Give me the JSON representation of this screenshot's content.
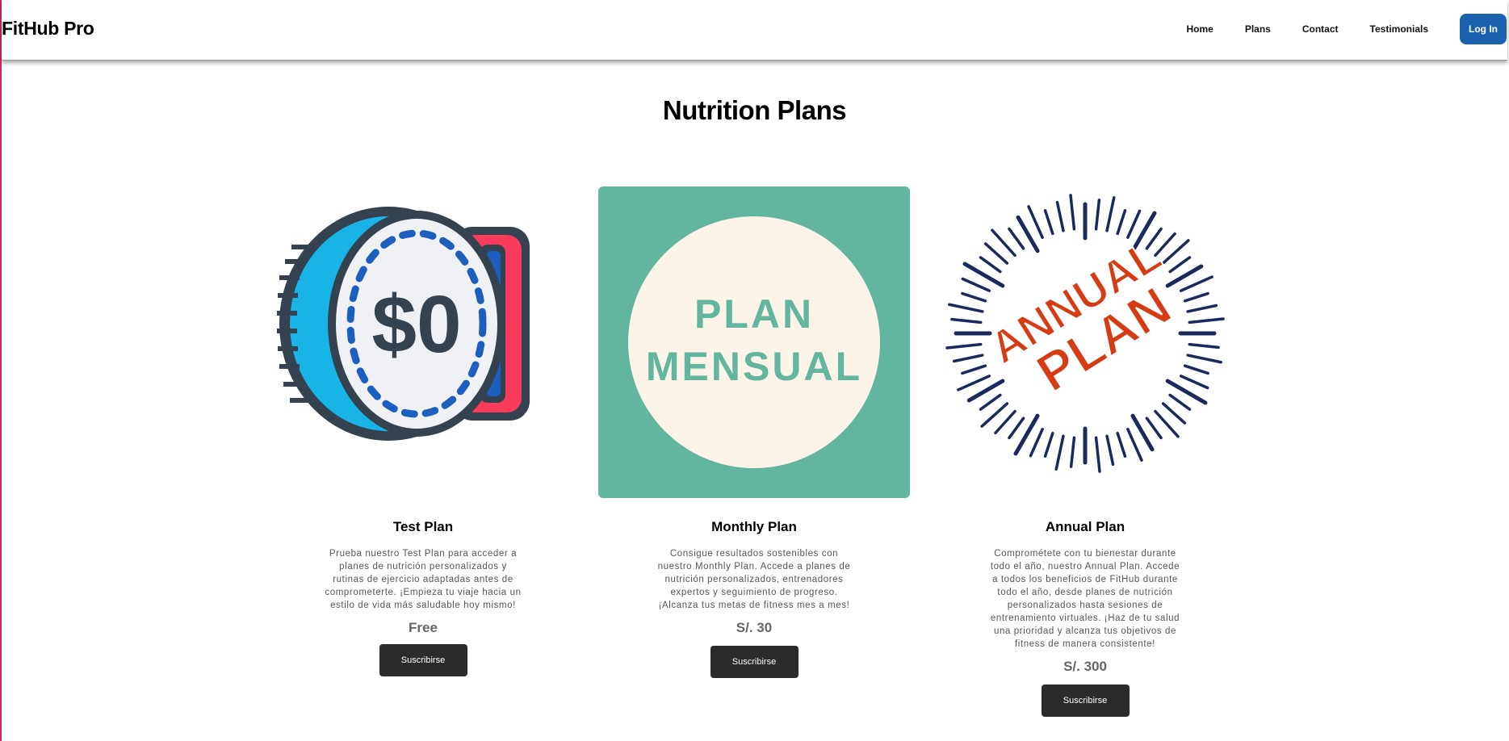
{
  "header": {
    "brand": "FitHub Pro",
    "nav": [
      "Home",
      "Plans",
      "Contact",
      "Testimonials"
    ],
    "login": "Log In"
  },
  "page": {
    "title": "Nutrition Plans"
  },
  "plans": [
    {
      "name": "Test Plan",
      "description": "Prueba nuestro Test Plan para acceder a planes de nutrición personalizados y rutinas de ejercicio adaptadas antes de comprometerte. ¡Empieza tu viaje hacia un estilo de vida más saludable hoy mismo!",
      "price": "Free",
      "button": "Suscribirse",
      "image_text": "$0"
    },
    {
      "name": "Monthly Plan",
      "description": "Consigue resultados sostenibles con nuestro Monthly Plan. Accede a planes de nutrición personalizados, entrenadores expertos y seguimiento de progreso. ¡Alcanza tus metas de fitness mes a mes!",
      "price": "S/. 30",
      "button": "Suscribirse",
      "image_text": [
        "PLAN",
        "MENSUAL"
      ]
    },
    {
      "name": "Annual Plan",
      "description": "Comprométete con tu bienestar durante todo el año, nuestro Annual Plan. Accede a todos los beneficios de FitHub durante todo el año, desde planes de nutrición personalizados hasta sesiones de entrenamiento virtuales. ¡Haz de tu salud una prioridad y alcanza tus objetivos de fitness de manera consistente!",
      "price": "S/. 300",
      "button": "Suscribirse",
      "image_text": [
        "ANNUAL",
        "PLAN"
      ]
    }
  ],
  "colors": {
    "accent": "#1b62ae",
    "button_dark": "#2b2b2b",
    "monthly_bg": "#62b59f",
    "monthly_circle": "#fdf4e9",
    "annual_red": "#d63b14",
    "annual_navy": "#1b2a5c"
  }
}
